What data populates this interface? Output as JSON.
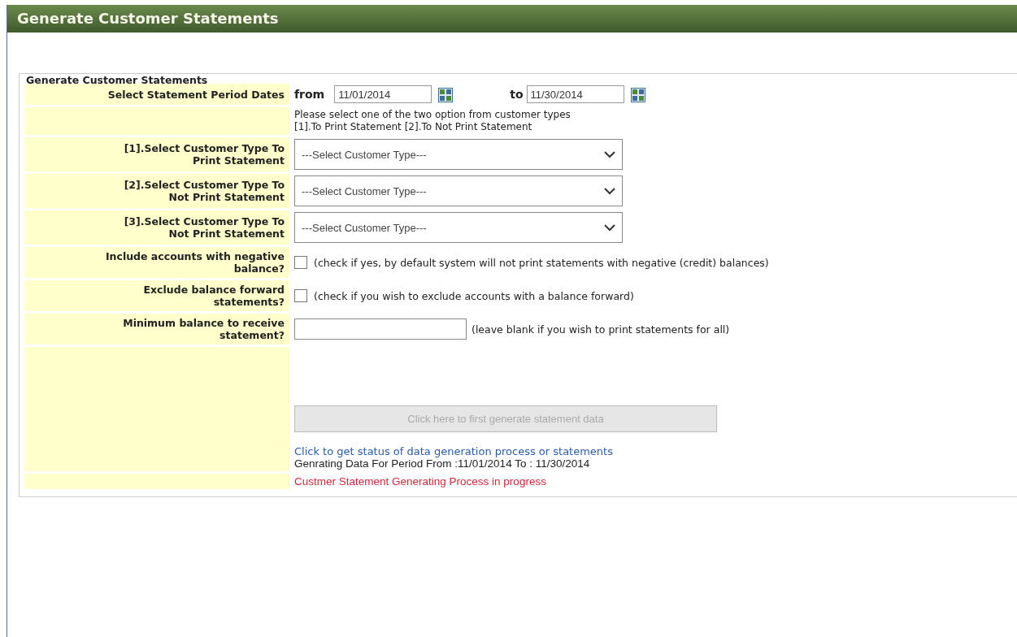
{
  "header": {
    "title": "Generate Customer Statements"
  },
  "legend": "Generate Customer Statements",
  "period": {
    "label": "Select Statement Period Dates",
    "from_label": "from",
    "from_value": "11/01/2014",
    "to_label": "to",
    "to_value": "11/30/2014"
  },
  "note": {
    "lines": [
      "Please select one of the two option from customer types",
      "[1].To Print Statement [2].To Not Print Statement"
    ]
  },
  "rows": [
    {
      "kind": "select",
      "label": "[1].Select Customer Type To\nPrint Statement",
      "placeholder": "---Select Customer Type---"
    },
    {
      "kind": "select",
      "label": "[2].Select Customer Type To\nNot Print Statement",
      "placeholder": "---Select Customer Type---"
    },
    {
      "kind": "select",
      "label": "[3].Select Customer Type To\nNot Print Statement",
      "placeholder": "---Select Customer Type---"
    },
    {
      "kind": "checkbox",
      "label": "Include accounts with negative\nbalance?",
      "checked": false,
      "hint": "(check if yes, by default system will not print statements with negative (credit) balances)"
    },
    {
      "kind": "checkbox",
      "label": "Exclude balance forward\nstatements?",
      "checked": false,
      "hint": "(check if you wish to exclude accounts with a balance forward)"
    },
    {
      "kind": "input",
      "label": "Minimum balance to receive\nstatement?",
      "hint": "(leave blank if you wish to print statements for all)"
    }
  ],
  "actions": {
    "button": {
      "label": "Click here to first generate statement data",
      "disabled": true
    },
    "status_link": "Click to get status of data generation process or statements",
    "period_text": "Genrating Data For Period From :11/01/2014 To : 11/30/2014"
  },
  "progress_text": "Custmer Statement Generating Process in progress"
}
